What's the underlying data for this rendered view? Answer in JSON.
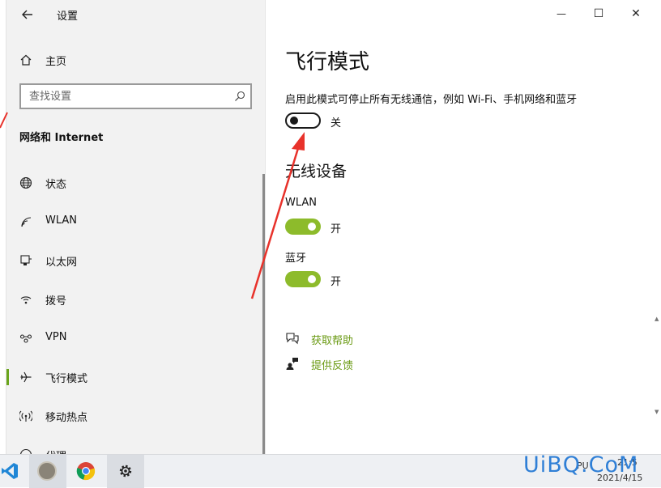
{
  "window": {
    "title": "设置",
    "minimize_glyph": "—",
    "maximize_glyph": "☐",
    "close_glyph": "✕"
  },
  "sidebar": {
    "home_label": "主页",
    "search_placeholder": "查找设置",
    "section_title": "网络和 Internet",
    "items": [
      {
        "label": "状态",
        "icon": "globe-icon"
      },
      {
        "label": "WLAN",
        "icon": "wifi-icon"
      },
      {
        "label": "以太网",
        "icon": "ethernet-icon"
      },
      {
        "label": "拨号",
        "icon": "dialup-icon"
      },
      {
        "label": "VPN",
        "icon": "vpn-icon"
      },
      {
        "label": "飞行模式",
        "icon": "airplane-icon",
        "selected": true
      },
      {
        "label": "移动热点",
        "icon": "hotspot-icon"
      },
      {
        "label": "代理",
        "icon": "proxy-icon"
      }
    ]
  },
  "main": {
    "title": "飞行模式",
    "description": "启用此模式可停止所有无线通信，例如 Wi-Fi、手机网络和蓝牙",
    "airplane_toggle": {
      "state": "off",
      "label": "关"
    },
    "wireless_section_title": "无线设备",
    "devices": [
      {
        "name": "WLAN",
        "state": "on",
        "label": "开"
      },
      {
        "name": "蓝牙",
        "state": "on",
        "label": "开"
      }
    ],
    "help_link": "获取帮助",
    "feedback_link": "提供反馈"
  },
  "taskbar": {
    "date": "2021/4/15",
    "time_partial": "21:5",
    "date_short": "PU"
  },
  "watermark": "UiBQ.CoM",
  "colors": {
    "accent": "#8dbb2b",
    "link": "#6a9a13",
    "annotation_arrow": "#e8322b",
    "watermark": "#2f7fd6"
  }
}
